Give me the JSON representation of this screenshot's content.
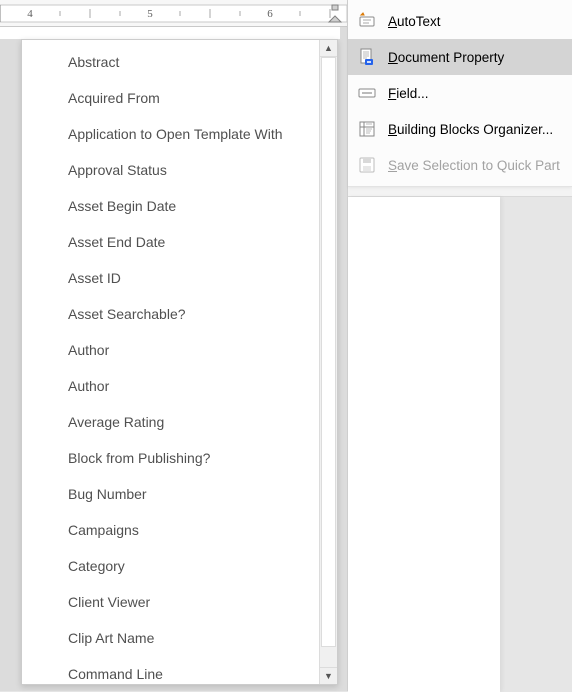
{
  "ruler_numbers": [
    "4",
    "5",
    "6"
  ],
  "property_list": [
    "Abstract",
    "Acquired From",
    "Application to Open Template With",
    "Approval Status",
    "Asset Begin Date",
    "Asset End Date",
    "Asset ID",
    "Asset Searchable?",
    "Author",
    "Author",
    "Average Rating",
    "Block from Publishing?",
    "Bug Number",
    "Campaigns",
    "Category",
    "Client Viewer",
    "Clip Art Name",
    "Command Line"
  ],
  "menu": [
    {
      "label": "AutoText",
      "accel_index": 0,
      "icon": "autotext-icon",
      "enabled": true,
      "highlight": false,
      "has_submenu": true,
      "ellipsis": false
    },
    {
      "label": "Document Property",
      "accel_index": 0,
      "icon": "document-icon",
      "enabled": true,
      "highlight": true,
      "has_submenu": true,
      "ellipsis": false
    },
    {
      "label": "Field...",
      "accel_index": 0,
      "icon": "field-icon",
      "enabled": true,
      "highlight": false,
      "has_submenu": false,
      "ellipsis": true
    },
    {
      "label": "Building Blocks Organizer...",
      "accel_index": 0,
      "icon": "organizer-icon",
      "enabled": true,
      "highlight": false,
      "has_submenu": false,
      "ellipsis": true
    },
    {
      "label": "Save Selection to Quick Part",
      "accel_index": 0,
      "icon": "save-icon",
      "enabled": false,
      "highlight": false,
      "has_submenu": false,
      "ellipsis": false
    }
  ]
}
